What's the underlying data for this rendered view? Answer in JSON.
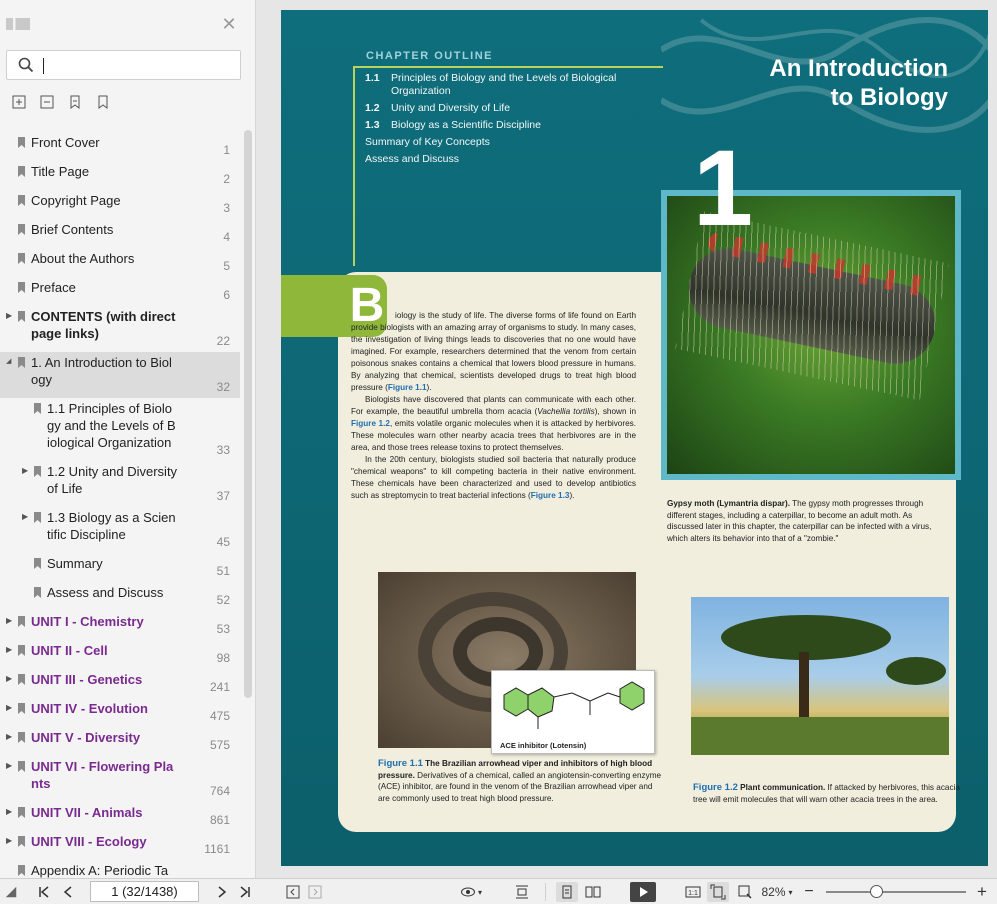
{
  "sidebar": {
    "search": {
      "value": "",
      "placeholder": ""
    },
    "bookmarks": [
      {
        "label": "Front Cover",
        "page": "1",
        "level": 0,
        "expandable": false,
        "style": "normal"
      },
      {
        "label": "Title Page",
        "page": "2",
        "level": 0,
        "expandable": false,
        "style": "normal"
      },
      {
        "label": "Copyright Page",
        "page": "3",
        "level": 0,
        "expandable": false,
        "style": "normal"
      },
      {
        "label": "Brief Contents",
        "page": "4",
        "level": 0,
        "expandable": false,
        "style": "normal"
      },
      {
        "label": "About the Authors",
        "page": "5",
        "level": 0,
        "expandable": false,
        "style": "normal"
      },
      {
        "label": "Preface",
        "page": "6",
        "level": 0,
        "expandable": false,
        "style": "normal"
      },
      {
        "label": "CONTENTS (with direct\npage links)",
        "page": "22",
        "level": 0,
        "expandable": true,
        "style": "bold"
      },
      {
        "label": "1. An Introduction to Biol\nogy",
        "page": "32",
        "level": 0,
        "expandable": true,
        "expanded": true,
        "style": "active"
      },
      {
        "label": "1.1 Principles of Biolo\ngy and the Levels of B\niological Organization",
        "page": "33",
        "level": 1,
        "expandable": false,
        "style": "normal"
      },
      {
        "label": "1.2 Unity and Diversity\nof Life",
        "page": "37",
        "level": 1,
        "expandable": true,
        "style": "normal"
      },
      {
        "label": "1.3 Biology as a Scien\ntific Discipline",
        "page": "45",
        "level": 1,
        "expandable": true,
        "style": "normal"
      },
      {
        "label": "Summary",
        "page": "51",
        "level": 1,
        "expandable": false,
        "style": "normal"
      },
      {
        "label": "Assess and Discuss",
        "page": "52",
        "level": 1,
        "expandable": false,
        "style": "normal"
      },
      {
        "label": "UNIT I - Chemistry",
        "page": "53",
        "level": 0,
        "expandable": true,
        "style": "unit"
      },
      {
        "label": "UNIT II - Cell",
        "page": "98",
        "level": 0,
        "expandable": true,
        "style": "unit"
      },
      {
        "label": "UNIT III - Genetics",
        "page": "241",
        "level": 0,
        "expandable": true,
        "style": "unit"
      },
      {
        "label": "UNIT IV - Evolution",
        "page": "475",
        "level": 0,
        "expandable": true,
        "style": "unit"
      },
      {
        "label": "UNIT V - Diversity",
        "page": "575",
        "level": 0,
        "expandable": true,
        "style": "unit"
      },
      {
        "label": "UNIT VI - Flowering Pla\nnts",
        "page": "764",
        "level": 0,
        "expandable": true,
        "style": "unit"
      },
      {
        "label": "UNIT VII - Animals",
        "page": "861",
        "level": 0,
        "expandable": true,
        "style": "unit"
      },
      {
        "label": "UNIT VIII - Ecology",
        "page": "1161",
        "level": 0,
        "expandable": true,
        "style": "unit"
      },
      {
        "label": "Appendix A: Periodic Ta",
        "page": "",
        "level": 0,
        "expandable": false,
        "style": "normal"
      }
    ]
  },
  "page": {
    "outline_heading": "CHAPTER OUTLINE",
    "outline": [
      {
        "num": "1.1",
        "text": "Principles of Biology and the Levels of Biological Organization"
      },
      {
        "num": "1.2",
        "text": "Unity and Diversity of Life"
      },
      {
        "num": "1.3",
        "text": "Biology as a Scientific Discipline"
      },
      {
        "num": "",
        "text": "Summary of Key Concepts"
      },
      {
        "num": "",
        "text": "Assess and Discuss"
      }
    ],
    "title_line1": "An Introduction",
    "title_line2": "to Biology",
    "chapter_number": "1",
    "drop_cap": "B",
    "para1": "iology is the study of life. The diverse forms of life found on Earth provide biologists with an amazing array of organisms to study. In many cases, the investigation of living things leads to discoveries that no one would have imagined. For example, researchers determined that the venom from certain poisonous snakes contains a chemical that lowers blood pressure in humans. By analyzing that chemical, scientists developed drugs to treat high blood pressure (",
    "para1_link": "Figure 1.1",
    "para1_end": ").",
    "para2a": "Biologists have discovered that plants can communicate with each other. For example, the beautiful umbrella thorn acacia (",
    "para2_italic": "Vachellia tortilis",
    "para2b": "), shown in ",
    "para2_link": "Figure 1.2",
    "para2c": ", emits volatile organic molecules when it is attacked by herbivores. These molecules warn other nearby acacia trees that herbivores are in the area, and those trees release toxins to protect themselves.",
    "para3a": "In the 20th century, biologists studied soil bacteria that naturally produce \"chemical weapons\" to kill competing bacteria in their native environment. These chemicals have been characterized and used to develop antibiotics such as streptomycin to treat bacterial infections (",
    "para3_link": "Figure 1.3",
    "para3_end": ").",
    "moth_caption_bold": "Gypsy moth (Lymantria dispar).",
    "moth_caption": " The gypsy moth progresses through different stages, including a caterpillar, to become an adult moth. As discussed later in this chapter, the caterpillar can be infected with a virus, which alters its behavior into that of a \"zombie.\"",
    "chem_label": "ACE inhibitor (Lotensin)",
    "fig11_num": "Figure 1.1",
    "fig11_bold": "The Brazilian arrowhead viper and inhibitors of high blood pressure.",
    "fig11_text": " Derivatives of a chemical, called an angiotensin-converting enzyme (ACE) inhibitor, are found in the venom of the Brazilian arrowhead viper and are commonly used to treat high blood pressure.",
    "fig12_num": "Figure 1.2",
    "fig12_bold": "Plant communication.",
    "fig12_text": " If attacked by herbivores, this acacia tree will emit molecules that will warn other acacia trees in the area."
  },
  "toolbar": {
    "page_indicator": "1 (32/1438)",
    "zoom": "82%",
    "zoom_level": 0.36
  }
}
